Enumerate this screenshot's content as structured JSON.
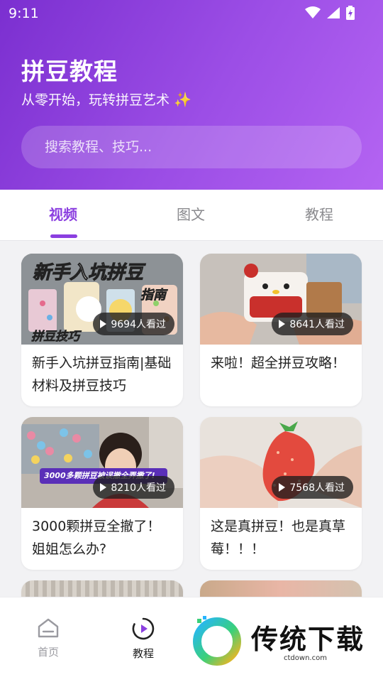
{
  "status": {
    "time": "9:11"
  },
  "header": {
    "title": "拼豆教程",
    "subtitle": "从零开始，玩转拼豆艺术"
  },
  "search": {
    "placeholder": "搜索教程、技巧..."
  },
  "tabs": [
    {
      "label": "视频",
      "active": true
    },
    {
      "label": "图文",
      "active": false
    },
    {
      "label": "教程",
      "active": false
    }
  ],
  "videos": [
    {
      "title": "新手入坑拼豆指南|基础材料及拼豆技巧",
      "views": "9694人看过",
      "thumb_text_1": "新手入坑拼豆",
      "thumb_text_2": "指南",
      "thumb_text_3": "拼豆技巧"
    },
    {
      "title": "来啦！超全拼豆攻略！",
      "views": "8641人看过"
    },
    {
      "title": "3000颗拼豆全撤了！姐姐怎么办?",
      "views": "8210人看过",
      "thumb_banner": "3000多颗拼豆被误撤全弄撒了!"
    },
    {
      "title": "这是真拼豆！也是真草莓！！！",
      "views": "7568人看过"
    }
  ],
  "bottom_nav": [
    {
      "label": "首页",
      "icon": "home-icon",
      "active": false
    },
    {
      "label": "教程",
      "icon": "play-circle-icon",
      "active": true
    }
  ],
  "watermark": {
    "brand": "传统下载",
    "domain": "ctdown.com"
  },
  "colors": {
    "accent": "#8b3fe0",
    "header_start": "#7b2fd0",
    "header_end": "#b464f2"
  }
}
